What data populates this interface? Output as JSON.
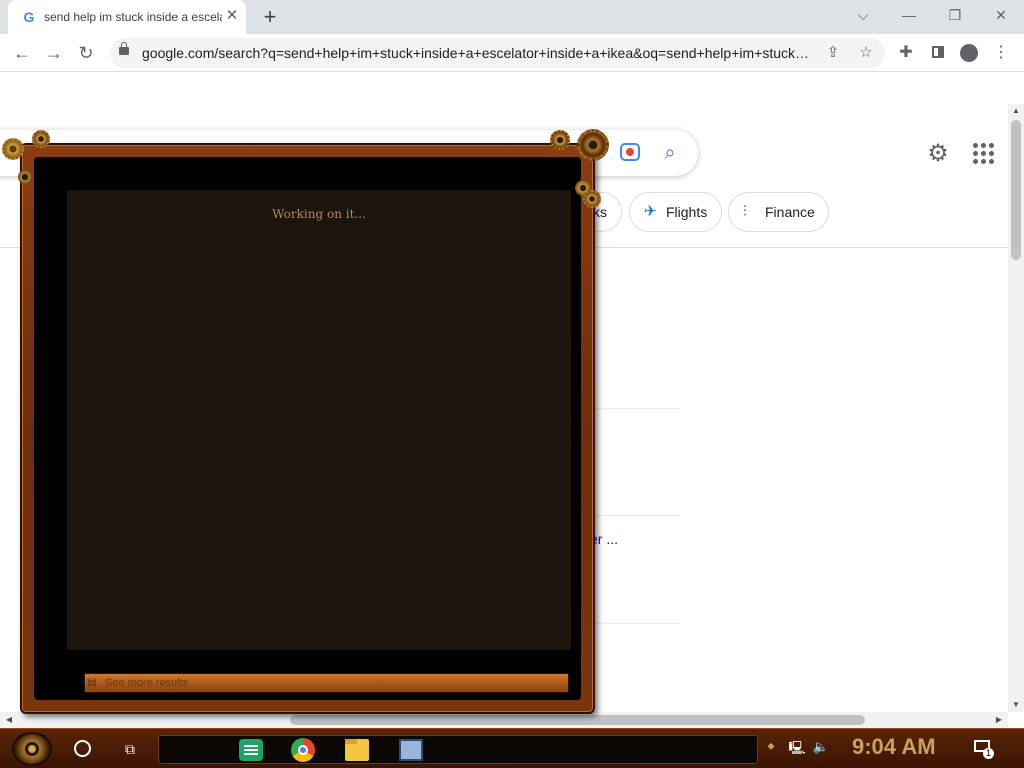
{
  "browser": {
    "tab": {
      "title": "send help im stuck inside a escelator inside a ikea",
      "favicon": "google-g-icon"
    },
    "new_tab_label": "+",
    "controls": {
      "chevron": "⌵",
      "minimize": "—",
      "restore": "❐",
      "close": "✕"
    },
    "nav": {
      "back": "←",
      "forward": "→",
      "reload": "↻"
    },
    "url": "google.com/search?q=send+help+im+stuck+inside+a+escelator+inside+a+ikea&oq=send+help+im+stuck+i..."
  },
  "google": {
    "chips": [
      {
        "label": "Flights",
        "icon": "airplane-icon"
      },
      {
        "label": "Finance",
        "icon": "finance-chart-icon"
      }
    ],
    "partial_chip_text": "ks",
    "partial_link_text": "er ..."
  },
  "overlay": {
    "status_text": "Working on it...",
    "more_results_label": "See more results"
  },
  "taskbar": {
    "clock": "9:04 AM",
    "apps": [
      "google-sheets",
      "google-chrome",
      "file-explorer",
      "this-pc"
    ],
    "notification_count": "1"
  },
  "colors": {
    "panel_frame": "#7a350f",
    "panel_inner": "#1d140d",
    "clock_text": "#c9a25a",
    "google_blue": "#4285f4"
  }
}
